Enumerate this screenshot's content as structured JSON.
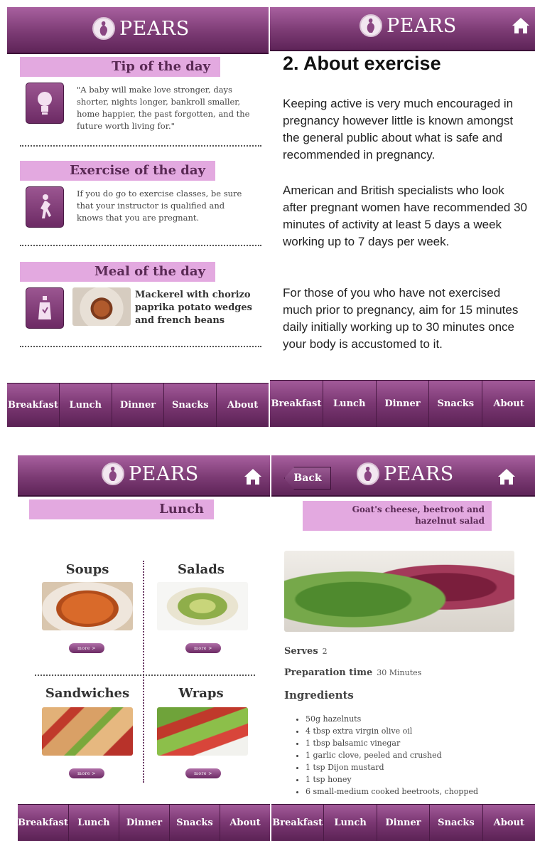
{
  "app": {
    "brand": "PEARS"
  },
  "nav": [
    "Breakfast",
    "Lunch",
    "Dinner",
    "Snacks",
    "About"
  ],
  "home_screen": {
    "tip": {
      "heading": "Tip of the day",
      "text": "\"A baby will make love stronger, days shorter, nights longer, bankroll smaller, home happier, the past forgotten, and the future worth living for.\""
    },
    "exercise": {
      "heading": "Exercise of the day",
      "text": "If you do go to exercise classes, be sure that your instructor is qualified and knows that you are pregnant."
    },
    "meal": {
      "heading": "Meal of the day",
      "text": "Mackerel with chorizo paprika potato wedges and french beans"
    }
  },
  "about_screen": {
    "title": "2. About exercise",
    "paragraphs": [
      "Keeping active is very much encouraged in pregnancy however little is known amongst the general public about what is safe and recommended in pregnancy.",
      "American and British specialists who look after pregnant women have recommended 30 minutes of activity at least 5 days a week working up to 7 days per week.",
      "For those of you who have not exercised much prior to pregnancy, aim for 15 minutes daily initially working up to 30 minutes once your body is accustomed to it."
    ]
  },
  "lunch_screen": {
    "heading": "Lunch",
    "categories": [
      "Soups",
      "Salads",
      "Sandwiches",
      "Wraps"
    ],
    "more_label": "more >"
  },
  "recipe_screen": {
    "back_label": "Back",
    "title": "Goat's cheese, beetroot and hazelnut salad",
    "serves_label": "Serves",
    "serves_value": "2",
    "prep_label": "Preparation time",
    "prep_value": "30 Minutes",
    "ingredients_label": "Ingredients",
    "ingredients": [
      "50g hazelnuts",
      "4 tbsp extra virgin olive oil",
      "1 tbsp balsamic vinegar",
      "1 garlic clove, peeled and crushed",
      "1 tsp Dijon mustard",
      "1 tsp honey",
      "6 small-medium cooked beetroots, chopped"
    ]
  }
}
